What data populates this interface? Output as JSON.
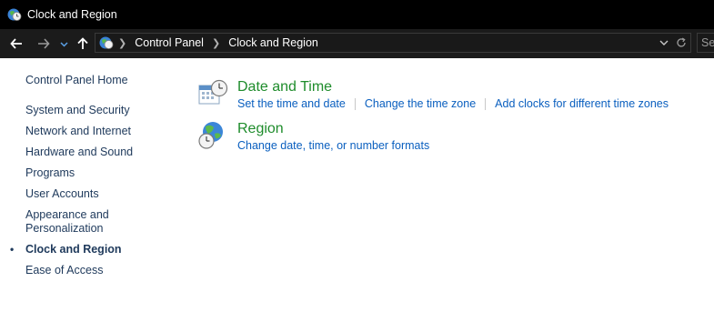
{
  "window": {
    "title": "Clock and Region",
    "icon": "clock-globe-icon"
  },
  "nav": {
    "back_icon": "arrow-left-icon",
    "forward_icon": "arrow-right-icon",
    "recent_icon": "chevron-down-icon",
    "up_icon": "arrow-up-icon",
    "breadcrumb": [
      "Control Panel",
      "Clock and Region"
    ],
    "dropdown_icon": "chevron-down-icon",
    "refresh_icon": "refresh-icon",
    "search_placeholder": "Se"
  },
  "sidebar": {
    "home": "Control Panel Home",
    "items": [
      "System and Security",
      "Network and Internet",
      "Hardware and Sound",
      "Programs",
      "User Accounts",
      "Appearance and Personalization",
      "Clock and Region",
      "Ease of Access"
    ],
    "current": "Clock and Region",
    "bullet": "•"
  },
  "categories": [
    {
      "title": "Date and Time",
      "icon": "calendar-clock-icon",
      "links": [
        "Set the time and date",
        "Change the time zone",
        "Add clocks for different time zones"
      ]
    },
    {
      "title": "Region",
      "icon": "globe-clock-icon",
      "links": [
        "Change date, time, or number formats"
      ]
    }
  ],
  "colors": {
    "category_title": "#1e8c2b",
    "link": "#0a5fbf",
    "sidebar_text": "#1e395b",
    "titlebar": "#000000",
    "navbar": "#1b1b1b"
  }
}
